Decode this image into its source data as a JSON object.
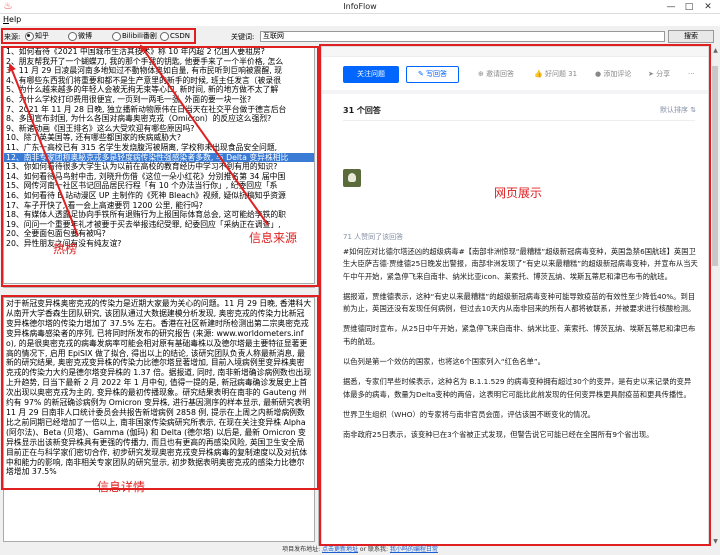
{
  "window": {
    "title": "InfoFlow",
    "app_icon": "flame-icon",
    "controls": [
      "—",
      "□",
      "✕"
    ]
  },
  "menu": {
    "help": "Help"
  },
  "toolbar": {
    "source_label": "来源:",
    "sources": [
      {
        "label": "知乎",
        "checked": true
      },
      {
        "label": "微博",
        "checked": false
      },
      {
        "label": "Bilibili番剧",
        "checked": false
      },
      {
        "label": "CSDN",
        "checked": false
      }
    ],
    "keyword_label": "关键词:",
    "keyword_value": "互联网",
    "search_label": "搜索"
  },
  "annotations": {
    "hot_list": "热榜",
    "source": "信息来源",
    "web_display": "网页展示",
    "detail": "信息详情",
    "color": "#e02020"
  },
  "hot_list": [
    "1、如何看待《2021 中国城市生活其技术》称 10 年内超 2 亿国人要租房?",
    "2、朋友帮我开了一个蝴蝶刀, 我的那个手我的钥匙, 他要手来了一个半价格, 怎么",
    "3、11 月 29 日凌晨河南多地知过不動物体奥如自量, 有市民听到巨响被震醒, 现",
    "4、有哪些东西我们将重要和都不是生产意里的新手的时候, 班主任发言〔被录很",
    "5、为什么越来越多的年轻人会被无拘无束等心口, 新时间, 新的地方做不太了解",
    "6、为什么学校打印费用很便宜, 一页到一两毛一张, 外面的要一块一张?",
    "7、2021 年 11 月 28 日晚, 独立播新动物原伟在日当天在社交平台做于德言后台",
    "8、多国宣布封国, 为什么各国对病毒奥密克戎（Omicron）的反应这么强烈?",
    "9、新诸动画《国王排名》这么大受欢迎有哪些原因吗?",
    "10、除了英美国等, 还有哪些都国家的疾病威胁大?",
    "11、广东一高校已有 315 名学生发烧腹泻被隔离, 学校称未出现食品安全问题,",
    "12、南非专家团称奥秘克戎多是轻度病传染性强感染者多数, 与 Delta 变异株相比",
    "13、你如何看待很多大学生认为以前在高校的教育经历中学习不到有用的知识?",
    "14、如何看待马鸟射中击, 刘晓升伤借《这位一朵小红花》分别推名第 34 届中国",
    "15、网传河南一社区书记回品居民行程「有 10 个办法当行你」, 纪委回应「系",
    "16、如何看待 B 站动漫区 UP 主制作的《死神 Bleach》视频, 疑似抗稿知乎资源",
    "17、车子开快了, 看一会上高速要罚 1200 公里, 能行吗?",
    "18、有媒体人透露足协向手铁所有退贿行为上报国际体育总会, 这可能给李铁的职",
    "19、问问一个重要年礼才被要于买去举报违纪受罪, 纪委回应「采纳正在调查」,",
    "20、全要面包面包要有被吗?",
    "20、异性朋友之间有没有纯友谊?"
  ],
  "selected_index": 11,
  "detail_text": "对于新冠变异株奥密克戎的传染力是近期大家最为关心的问题。11 月 29 日晚, 香港科大从南开大学香森生团队研究, 该团队通过大数据建模分析发现, 奥密克戎的传染力比新冠变异株德尔塔的传染力增加了 37.5% 左右。香港在社区新建时所检测出第二宗奥密克戎变异株病毒感染者的序列, 已将同时所发布的研究报告 (来源: www.worldometers.info), 的是很奥密克戎的病毒发病率可能会相对原有基础毒株以及德尔塔最主要特征显著更高的情况下, 启用 EpiSIX 做了拟合, 得出以上的结论, 该研究团队负责人称最新消息, 最新的研究结果, 奥密克戎变异株的传染力比德尔塔显著增加, 目前入境病例里变异株奥密克戎的传染力大约是德尔塔变异株的 1.37 倍。据报道, 同时, 南非新增确诊病例数也出现上升趋势, 日当下最新 2 月 2022 年 1 月中旬, 值得一提的是, 新冠病毒确诊发展史上首次出现以奥密克戎为主的, 变异株的最初传播现象。研究结果表明在南非的 Gauteng 州约有 97% 的新冠确诊病例为 Omicron 变异株, 进行基因测序的样本显示, 最新研究表明 11 月 29 日南非人口统计委员会共报告新增病例 2858 例, 提示在上周之内新增病例数比之前同期已经增加了一倍以上, 南非国家传染病研究所表示, 在现在关注变异株 Alpha (阿尔法)、Beta (贝塔)、Gamma (伽玛) 和 Delta (德尔塔) 以后是, 最新 Omicron 变异株显示出该新变异株具有更强的传播力, 而且也有更高的再感染风险, 英国卫生安全局目前正在与科学家们密切合作, 初步研究发现奥密克戎变异株病毒的复制速度以及对抗体中和能力的影响, 南非相关专家团队的研究显示, 初步数据表明奥密克戎的感染力比德尔塔增加 37.5%",
  "web": {
    "follow_label": "关注问题",
    "write_label": "写回答",
    "invite_label": "邀请回答",
    "good_label": "好问题 31",
    "comment_label": "添加评论",
    "share_label": "分享",
    "more_label": "···",
    "answers_count": "31 个回答",
    "sort_label": "默认排序",
    "likes_label": "71 人赞同了该回答",
    "paragraphs": [
      "#如何应对比德尔塔还凶的超级病毒#【南部非洲惊现“最糟糕”超级新冠病毒变种，英国急禁6国航班】英国卫生大臣萨吉德·贾维德25日晚发出警报，南部非洲发现了“有史以来最糟糕”的超级新冠病毒变种，并宣布从当天午中午开始，紧急停飞来自南非、纳米比亚icon、莱索托、博茨瓦纳、埃斯瓦蒂尼和津巴布韦的航班。",
      "据报道，贾维德表示，这种“有史以来最糟糕”的超级新冠病毒变种可能导致疫苗的有效性至少降低40%。到目前为止，英国还没有发现任何病例，但过去10天内从南非回来的所有人都将被联系，并被要求进行核酸检测。",
      "贾维德同时宣布，从25日中午开始，紧急停飞来自南非、纳米比亚、莱索托、博茨瓦纳、埃斯瓦蒂尼和津巴布韦的航班。",
      "以色列是第一个效仿的国家，也将这6个国家列入“红色名单”。",
      "据悉，专家们早些时候表示，这种名为 B.1.1.529 的病毒变种拥有超过30个的变异，是有史以来记录的变异体最多的病毒，数量为Delta变种的两倍，这表明它可能比此前发现的任何变异株更具耐疫苗和更具传播性。",
      "世界卫生组织（WHO）的专家将与南非官员会面，评估该国不断变化的情况。",
      "南非政府25日表示，该变种已在3个省被正式发现，但警告说它可能已经在全国所有9个省出现。"
    ]
  },
  "status": {
    "prefix": "项目发布地址: ",
    "link1": "点击更新地址",
    "mid": " or 联系我: ",
    "link2": "我小吗的编程日常"
  }
}
